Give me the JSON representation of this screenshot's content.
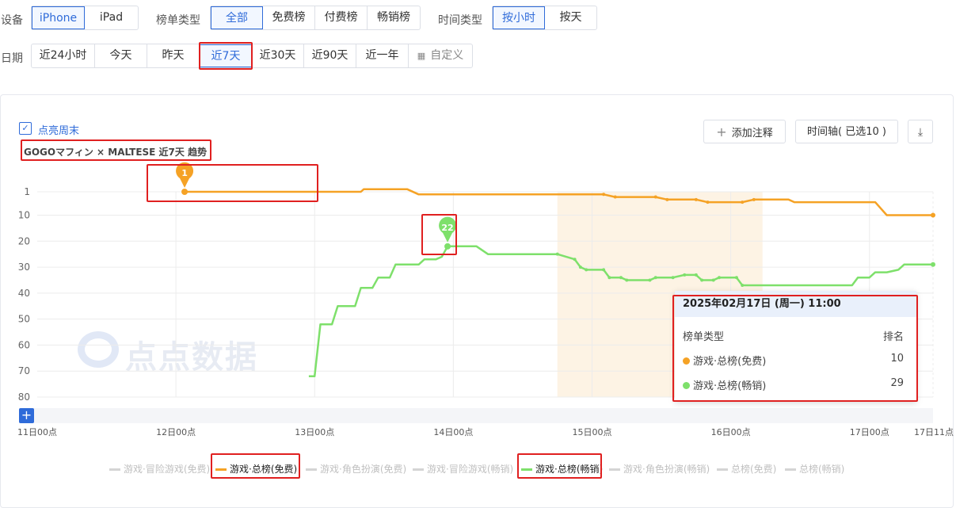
{
  "filters": {
    "device": {
      "label": "设备",
      "options": [
        "iPhone",
        "iPad"
      ],
      "active": 0
    },
    "chart_type": {
      "label": "榜单类型",
      "options": [
        "全部",
        "免费榜",
        "付费榜",
        "畅销榜"
      ],
      "active": 0
    },
    "time_type": {
      "label": "时间类型",
      "options": [
        "按小时",
        "按天"
      ],
      "active": 0
    },
    "date": {
      "label": "日期",
      "options": [
        "近24小时",
        "今天",
        "昨天",
        "近7天",
        "近30天",
        "近90天",
        "近一年",
        "自定义"
      ],
      "active": 3
    }
  },
  "weekend_toggle": {
    "label": "点亮周末",
    "checked": true
  },
  "chart_title": "GOGOマフィン × MALTESE 近7天 趋势",
  "toolbar": {
    "annotate": "添加注释",
    "timeline": "时间轴( 已选10 )"
  },
  "watermark": "点点数据",
  "markers": [
    {
      "label": "1",
      "series": 0,
      "color": "#f5a225"
    },
    {
      "label": "22",
      "series": 1,
      "color": "#7ee06b"
    }
  ],
  "tooltip": {
    "title": "2025年02月17日 (周一) 11:00",
    "col1": "榜单类型",
    "col2": "排名",
    "rows": [
      {
        "name": "游戏·总榜(免费)",
        "value": "10",
        "color": "#f5a225"
      },
      {
        "name": "游戏·总榜(畅销)",
        "value": "29",
        "color": "#7ee06b"
      }
    ]
  },
  "legend": [
    {
      "label": "游戏·冒险游戏(免费)",
      "active": false,
      "color": "#d4d4d4"
    },
    {
      "label": "游戏·总榜(免费)",
      "active": true,
      "color": "#f5a225"
    },
    {
      "label": "游戏·角色扮演(免费)",
      "active": false,
      "color": "#d4d4d4"
    },
    {
      "label": "游戏·冒险游戏(畅销)",
      "active": false,
      "color": "#d4d4d4"
    },
    {
      "label": "游戏·总榜(畅销)",
      "active": true,
      "color": "#7ee06b"
    },
    {
      "label": "游戏·角色扮演(畅销)",
      "active": false,
      "color": "#d4d4d4"
    },
    {
      "label": "总榜(免费)",
      "active": false,
      "color": "#d4d4d4"
    },
    {
      "label": "总榜(畅销)",
      "active": false,
      "color": "#d4d4d4"
    }
  ],
  "chart_data": {
    "type": "line",
    "title": "GOGOマフィン × MALTESE 近7天 趋势",
    "xlabel": "",
    "ylabel": "",
    "y_inverted": true,
    "ylim": [
      1,
      80
    ],
    "yticks": [
      1,
      10,
      20,
      30,
      40,
      50,
      60,
      70,
      80
    ],
    "xticks": [
      {
        "t": 0,
        "label": "11日00点"
      },
      {
        "t": 24,
        "label": "12日00点"
      },
      {
        "t": 48,
        "label": "13日00点"
      },
      {
        "t": 72,
        "label": "14日00点"
      },
      {
        "t": 96,
        "label": "15日00点"
      },
      {
        "t": 120,
        "label": "16日00点"
      },
      {
        "t": 144,
        "label": "17日00点"
      },
      {
        "t": 155,
        "label": "17日11点"
      }
    ],
    "x_unit": "hours since 11日00点",
    "weekend_band": [
      90,
      125.5
    ],
    "grid": true,
    "series": [
      {
        "name": "游戏·总榜(免费)",
        "color": "#f5a225",
        "points": [
          [
            25.5,
            1
          ],
          [
            56,
            1
          ],
          [
            56.5,
            0
          ],
          [
            64,
            0
          ],
          [
            66,
            2
          ],
          [
            98,
            2
          ],
          [
            100,
            3
          ],
          [
            107,
            3
          ],
          [
            109,
            4
          ],
          [
            114,
            4
          ],
          [
            116,
            5
          ],
          [
            122,
            5
          ],
          [
            124,
            4
          ],
          [
            130,
            4
          ],
          [
            131,
            5
          ],
          [
            145,
            5
          ],
          [
            147,
            10
          ],
          [
            155,
            10
          ]
        ]
      },
      {
        "name": "游戏·总榜(畅销)",
        "color": "#7ee06b",
        "points": [
          [
            47,
            72
          ],
          [
            48,
            72
          ],
          [
            49,
            52
          ],
          [
            51,
            52
          ],
          [
            52,
            45
          ],
          [
            55,
            45
          ],
          [
            56,
            38
          ],
          [
            58,
            38
          ],
          [
            59,
            34
          ],
          [
            61,
            34
          ],
          [
            62,
            29
          ],
          [
            66,
            29
          ],
          [
            67,
            27
          ],
          [
            69,
            27
          ],
          [
            70,
            26
          ],
          [
            71,
            22
          ],
          [
            76,
            22
          ],
          [
            78,
            25
          ],
          [
            90,
            25
          ],
          [
            93,
            27
          ],
          [
            94,
            30
          ],
          [
            95,
            31
          ],
          [
            98,
            31
          ],
          [
            99,
            34
          ],
          [
            101,
            34
          ],
          [
            102,
            35
          ],
          [
            106,
            35
          ],
          [
            107,
            34
          ],
          [
            110,
            34
          ],
          [
            112,
            33
          ],
          [
            114,
            33
          ],
          [
            115,
            35
          ],
          [
            117,
            35
          ],
          [
            118,
            34
          ],
          [
            121,
            34
          ],
          [
            122,
            37
          ],
          [
            126,
            37
          ],
          [
            129,
            37
          ],
          [
            141,
            37
          ],
          [
            142,
            34
          ],
          [
            144,
            34
          ],
          [
            145,
            32
          ],
          [
            147,
            32
          ],
          [
            149,
            31
          ],
          [
            150,
            29
          ],
          [
            155,
            29
          ]
        ]
      }
    ]
  }
}
